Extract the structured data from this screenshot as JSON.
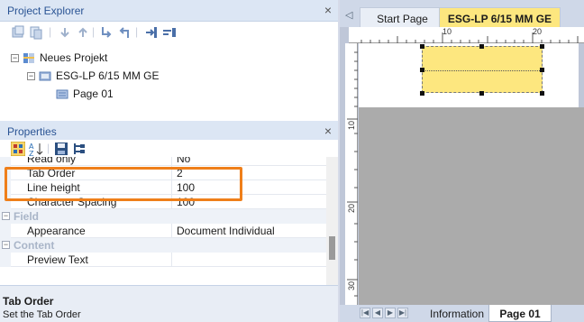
{
  "project_explorer": {
    "title": "Project Explorer",
    "close_glyph": "×",
    "toolbar_icons": [
      "add-icon",
      "copy-icon",
      "move-down-icon",
      "move-up-icon",
      "indent-icon",
      "outdent-icon",
      "insert-icon",
      "lines-icon"
    ],
    "tree": [
      {
        "label": "Neues Projekt",
        "expander": "−",
        "icon": "project-icon"
      },
      {
        "label": "ESG-LP 6/15 MM GE",
        "expander": "−",
        "icon": "device-icon"
      },
      {
        "label": "Page 01",
        "icon": "page-icon"
      }
    ]
  },
  "properties": {
    "title": "Properties",
    "close_glyph": "×",
    "toolbar_icons": [
      "categorized-icon",
      "alphabetical-icon",
      "save-icon",
      "tree-icon"
    ],
    "rows": [
      {
        "kind": "prop",
        "name": "Read only",
        "value": "No"
      },
      {
        "kind": "prop",
        "name": "Tab Order",
        "value": "2"
      },
      {
        "kind": "prop",
        "name": "Line height",
        "value": "100"
      },
      {
        "kind": "prop",
        "name": "Character Spacing",
        "value": "100"
      },
      {
        "kind": "category",
        "name": "Field",
        "expander": "−"
      },
      {
        "kind": "prop",
        "name": "Appearance",
        "value": "Document Individual"
      },
      {
        "kind": "category",
        "name": "Content",
        "expander": "−"
      },
      {
        "kind": "prop",
        "name": "Preview Text",
        "value": ""
      }
    ],
    "description": {
      "title": "Tab Order",
      "text": "Set the Tab Order"
    }
  },
  "editor": {
    "tab_arrow": "◁",
    "tabs": [
      {
        "label": "Start Page",
        "active": false
      },
      {
        "label": "ESG-LP 6/15 MM GE",
        "active": true
      }
    ],
    "ruler_top": [
      "10",
      "20"
    ],
    "ruler_left": [
      "10",
      "20",
      "30"
    ],
    "bottom_tabs": [
      {
        "label": "Information",
        "active": false
      },
      {
        "label": "Page 01",
        "active": true
      }
    ],
    "nav_glyphs": [
      "|◀",
      "◀",
      "▶",
      "▶|"
    ]
  },
  "colors": {
    "highlight": "#ef7f1a",
    "field_fill": "#fde77f",
    "header_text": "#2a5494"
  }
}
